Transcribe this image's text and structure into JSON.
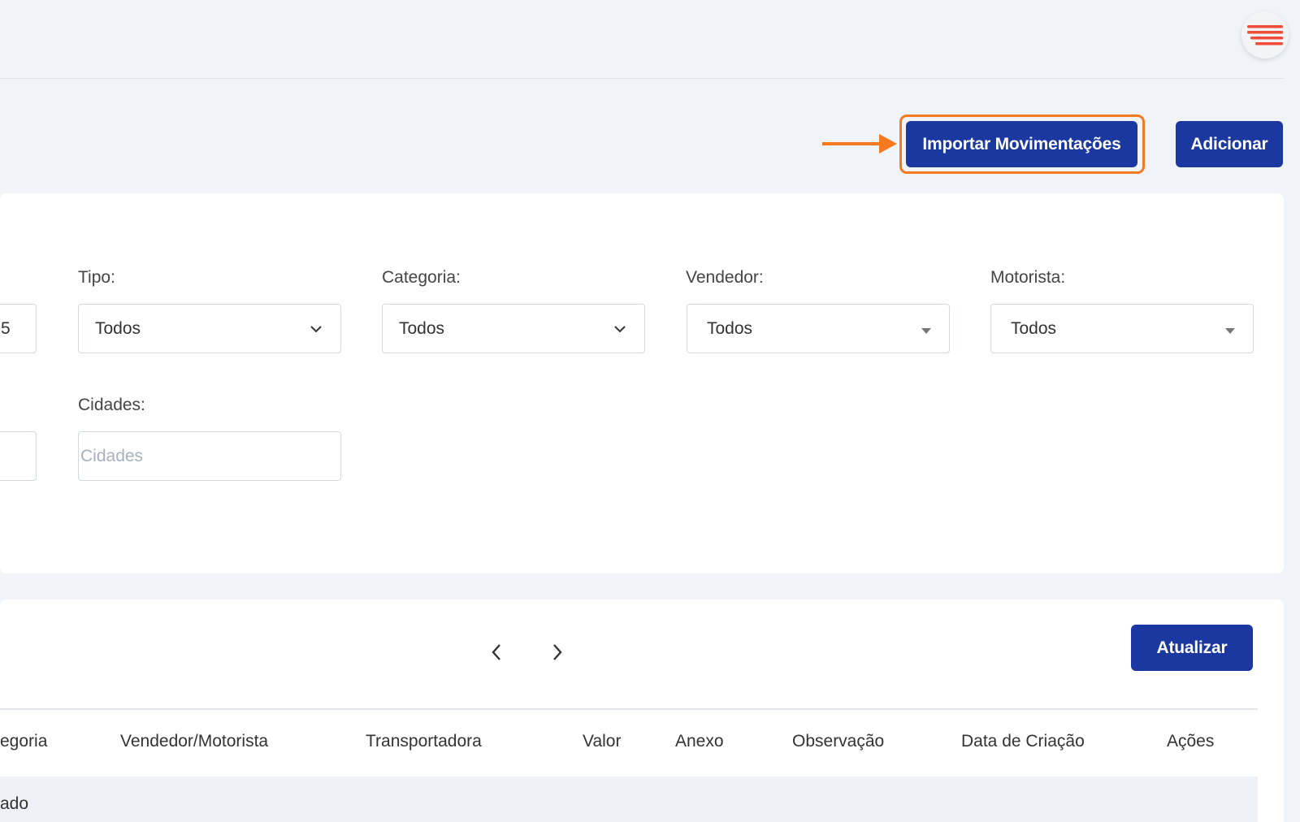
{
  "header": {
    "menu_icon": "hamburger-menu-icon",
    "accent_color": "#f04e37"
  },
  "actions": {
    "import_label": "Importar Movimentações",
    "add_label": "Adicionar",
    "highlight_color": "#f57a1f",
    "button_color": "#1b37a0"
  },
  "filters": {
    "partial_value": "5",
    "tipo": {
      "label": "Tipo:",
      "value": "Todos"
    },
    "categoria": {
      "label": "Categoria:",
      "value": "Todos"
    },
    "vendedor": {
      "label": "Vendedor:",
      "value": "Todos"
    },
    "motorista": {
      "label": "Motorista:",
      "value": "Todos"
    },
    "cidades": {
      "label": "Cidades:",
      "placeholder": "Cidades",
      "value": ""
    }
  },
  "table": {
    "refresh_label": "Atualizar",
    "columns": [
      "egoria",
      "Vendedor/Motorista",
      "Transportadora",
      "Valor",
      "Anexo",
      "Observação",
      "Data de Criação",
      "Ações"
    ],
    "rows": [
      {
        "first_cell": "ado"
      }
    ]
  }
}
